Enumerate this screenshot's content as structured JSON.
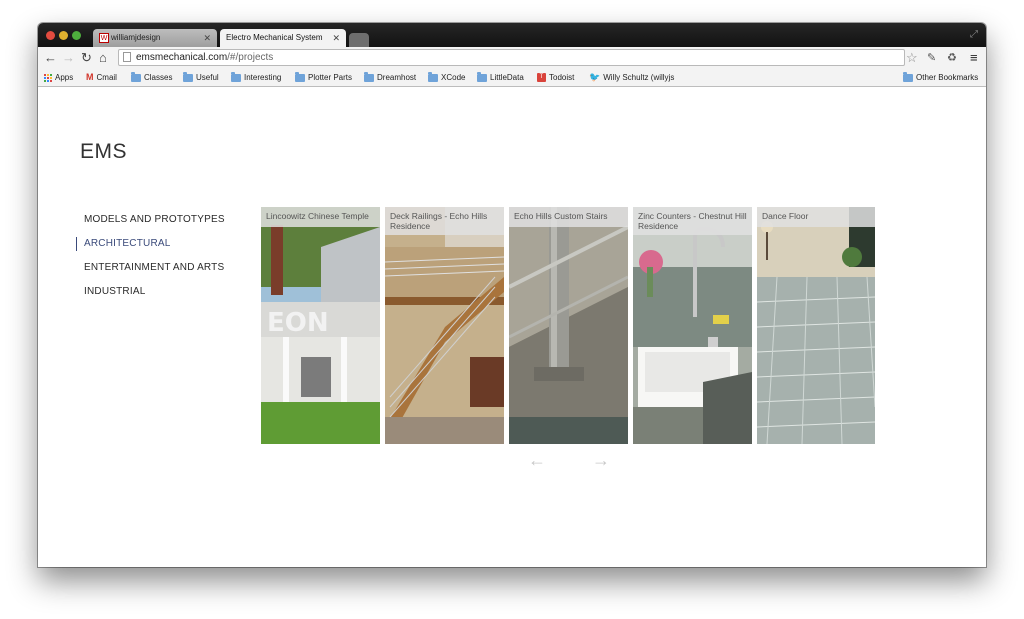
{
  "browser": {
    "tabs": [
      {
        "label": "williamjdesign",
        "favicon": "W",
        "active": false
      },
      {
        "label": "Electro Mechanical System",
        "active": true
      }
    ],
    "url_host": "emsmechanical.com",
    "url_path": "/#/projects",
    "bookmarks": [
      {
        "label": "Apps",
        "icon": "apps-grid-icon"
      },
      {
        "label": "Cmail",
        "icon": "gmail-icon"
      },
      {
        "label": "Classes",
        "icon": "folder-icon"
      },
      {
        "label": "Useful",
        "icon": "folder-icon"
      },
      {
        "label": "Interesting",
        "icon": "folder-icon"
      },
      {
        "label": "Plotter Parts",
        "icon": "folder-icon"
      },
      {
        "label": "Dreamhost",
        "icon": "folder-icon"
      },
      {
        "label": "XCode",
        "icon": "folder-icon"
      },
      {
        "label": "LittleData",
        "icon": "folder-icon"
      },
      {
        "label": "Todoist",
        "icon": "todoist-icon"
      },
      {
        "label": "Willy Schultz (willyjs",
        "icon": "twitter-bird-icon"
      }
    ],
    "other_bookmarks": "Other Bookmarks"
  },
  "site": {
    "title": "EMS",
    "nav": [
      {
        "label": "MODELS AND PROTOTYPES",
        "active": false
      },
      {
        "label": "ARCHITECTURAL",
        "active": true
      },
      {
        "label": "ENTERTAINMENT AND ARTS",
        "active": false
      },
      {
        "label": "INDUSTRIAL",
        "active": false
      }
    ],
    "projects": [
      {
        "caption": "Lincoowitz Chinese Temple"
      },
      {
        "caption": "Deck Railings - Echo Hills\nResidence"
      },
      {
        "caption": "Echo Hills Custom Stairs"
      },
      {
        "caption": "Zinc Counters - Chestnut Hill\nResidence"
      },
      {
        "caption": "Dance Floor"
      }
    ],
    "arrows": {
      "prev": "←",
      "next": "→"
    }
  },
  "colors": {
    "accent": "#3a4a7a",
    "title_text": "#333333",
    "arrow": "#c8c8c8"
  }
}
